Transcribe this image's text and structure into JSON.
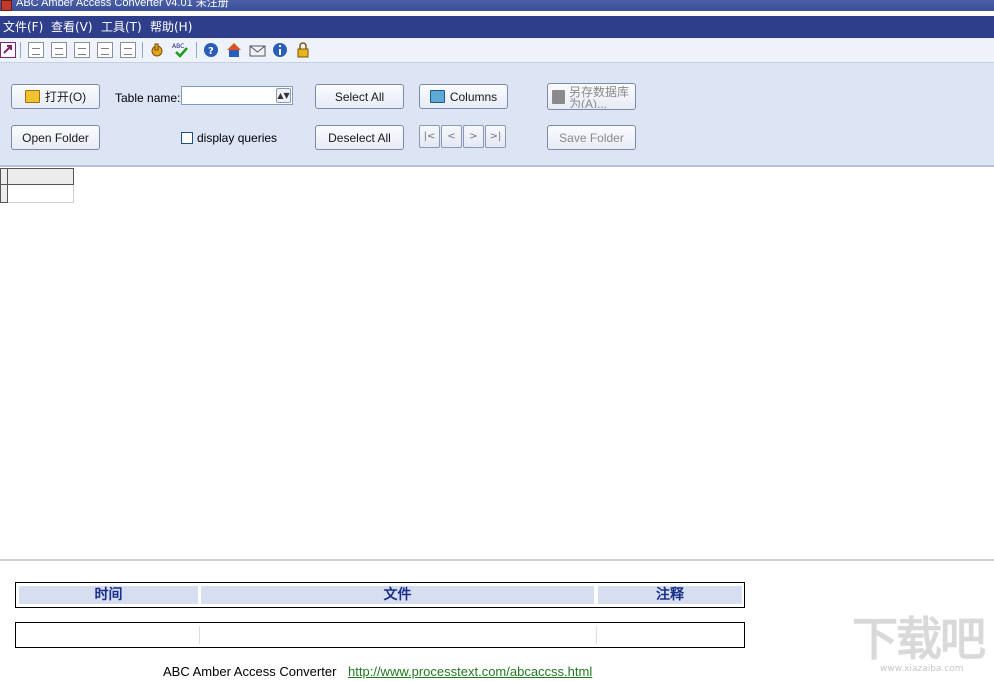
{
  "window": {
    "title": "ABC Amber Access Converter v4.01 未注册"
  },
  "menu": {
    "items": [
      "文件(F)",
      "查看(V)",
      "工具(T)",
      "帮助(H)"
    ]
  },
  "toolbar": {
    "icons": [
      "open-icon",
      "xls-icon",
      "doc-icon",
      "pdf-icon",
      "html-icon",
      "rtf-icon",
      "hand-icon",
      "spellcheck-icon",
      "help-icon",
      "home-icon",
      "mail-icon",
      "info-icon",
      "register-icon"
    ]
  },
  "controls": {
    "open_label": "打开(O)",
    "table_name_label": "Table name:",
    "table_name_value": "",
    "select_all_label": "Select All",
    "columns_label": "Columns",
    "save_db_label": "另存数据库为(A)...",
    "open_folder_label": "Open Folder",
    "display_queries_label": "display queries",
    "deselect_all_label": "Deselect All",
    "save_folder_label": "Save Folder",
    "nav": [
      "|<",
      "<",
      ">",
      ">|"
    ]
  },
  "log": {
    "columns": [
      "时间",
      "文件",
      "注释"
    ]
  },
  "footer": {
    "app_name": "ABC Amber Access Converter",
    "url": "http://www.processtext.com/abcaccss.html"
  },
  "watermark": {
    "text": "下载吧",
    "sub": "www.xiazaiba.com"
  },
  "colors": {
    "menubar": "#2f3e8a",
    "panel": "#dde4f3",
    "log_header_bg": "#d6def0",
    "log_header_text": "#1a2f8a",
    "link": "#1f7a1f"
  }
}
